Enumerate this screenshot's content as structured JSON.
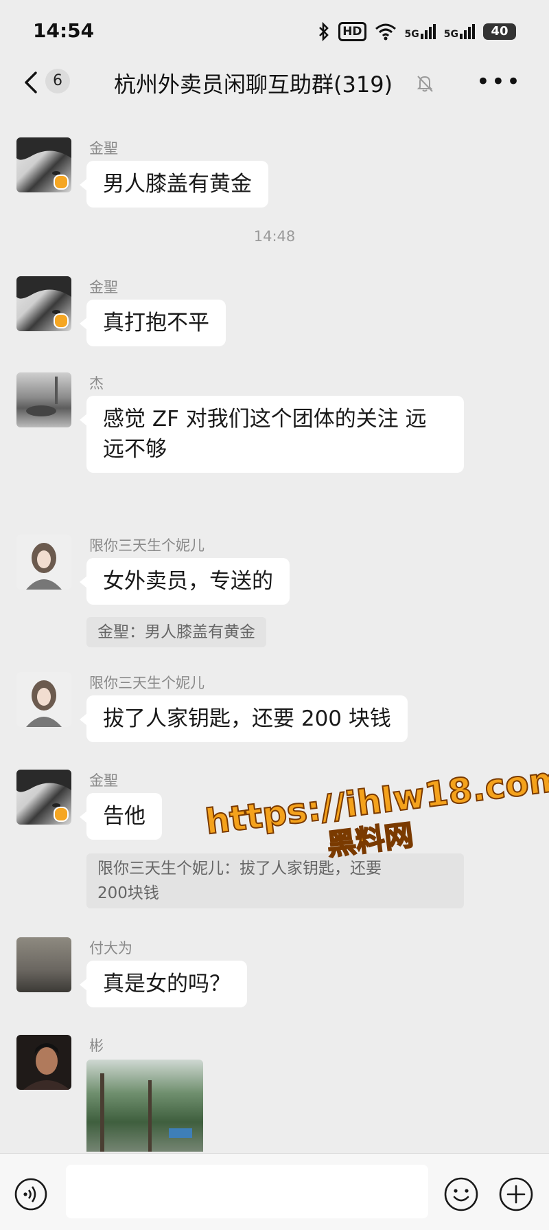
{
  "status_bar": {
    "time": "14:54",
    "hd_label": "HD",
    "network_1": "5G",
    "network_2": "5G",
    "battery": "40"
  },
  "header": {
    "unread_count": "6",
    "title": "杭州外卖员闲聊互助群(319)"
  },
  "timestamp": "14:48",
  "messages": [
    {
      "sender": "金聖",
      "text": "男人膝盖有黄金",
      "verified": true
    },
    {
      "sender": "金聖",
      "text": "真打抱不平",
      "verified": true
    },
    {
      "sender": "杰",
      "text_line1": "感觉 ZF 对我们这个团体的关注 远",
      "text_line2": "远不够"
    },
    {
      "sender": "限你三天生个妮儿",
      "text": "女外卖员，专送的",
      "quote": "金聖：男人膝盖有黄金"
    },
    {
      "sender": "限你三天生个妮儿",
      "text": "拔了人家钥匙，还要 200 块钱"
    },
    {
      "sender": "金聖",
      "text": "告他",
      "verified": true,
      "quote_line1": "限你三天生个妮儿：拔了人家钥匙，还要",
      "quote_line2": "200块钱"
    },
    {
      "sender": "付大为",
      "text": "真是女的吗？"
    },
    {
      "sender": "彬",
      "type": "image"
    }
  ],
  "watermark": {
    "url": "https://ihlw18.com",
    "name": "黑料网"
  },
  "colors": {
    "background": "#ededed",
    "bubble": "#ffffff",
    "quote_bg": "#e3e3e3",
    "verified_badge": "#f5a623",
    "watermark": "#f4a21c"
  },
  "icons": {
    "back": "chevron-left-icon",
    "mute": "bell-off-icon",
    "more": "more-dots-icon",
    "voice": "voice-icon",
    "emoji": "smiley-icon",
    "plus": "plus-circle-icon"
  }
}
